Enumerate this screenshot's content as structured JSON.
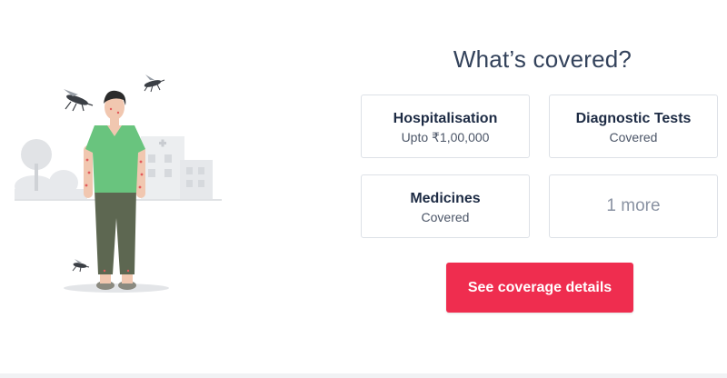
{
  "section": {
    "heading": "What’s covered?"
  },
  "coverage_cards": [
    {
      "title": "Hospitalisation",
      "subtitle": "Upto ₹1,00,000"
    },
    {
      "title": "Diagnostic Tests",
      "subtitle": "Covered"
    },
    {
      "title": "Medicines",
      "subtitle": "Covered"
    }
  ],
  "more_card": {
    "label": "1 more"
  },
  "cta": {
    "label": "See coverage details"
  },
  "colors": {
    "accent": "#ef2d4f",
    "heading": "#33425b",
    "card_border": "#dde1e7"
  },
  "illustration": {
    "icons": [
      "mosquito-icon",
      "hospital-building-icon",
      "tree-icon",
      "person-icon"
    ]
  }
}
